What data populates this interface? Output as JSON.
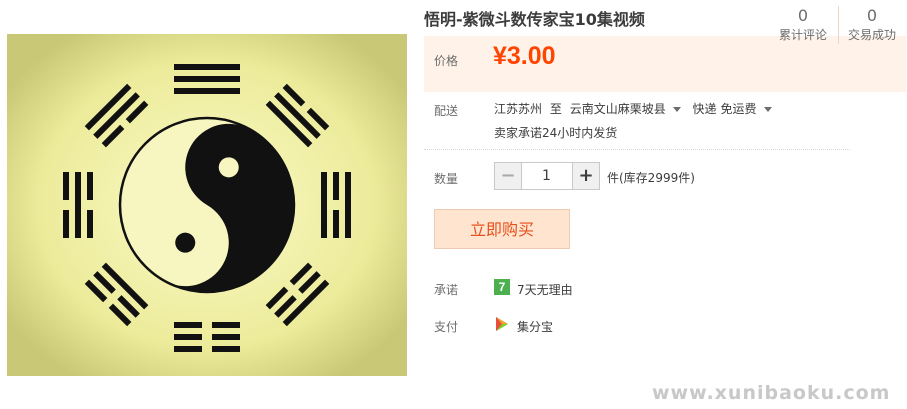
{
  "product": {
    "title": "悟明-紫微斗数传家宝10集视频",
    "image_icon": "yin-yang-bagua"
  },
  "price": {
    "label": "价格",
    "value": "¥3.00",
    "color": "#ff4400"
  },
  "stats": {
    "reviews_count": "0",
    "reviews_label": "累计评论",
    "sales_count": "0",
    "sales_label": "交易成功"
  },
  "shipping": {
    "label": "配送",
    "from": "江苏苏州",
    "to_word": "至",
    "destination": "云南文山麻栗坡县",
    "method": "快递",
    "fee": "免运费",
    "promise": "卖家承诺24小时内发货"
  },
  "quantity": {
    "label": "数量",
    "minus": "−",
    "value": "1",
    "plus": "+",
    "stock": "件(库存2999件)"
  },
  "buy": {
    "label": "立即购买",
    "accent": "#e5511d"
  },
  "guarantee": {
    "label": "承诺",
    "icon_text": "7",
    "text": "7天无理由"
  },
  "payment": {
    "label": "支付",
    "text": "集分宝"
  },
  "watermark": "www.xunibaoku.com"
}
